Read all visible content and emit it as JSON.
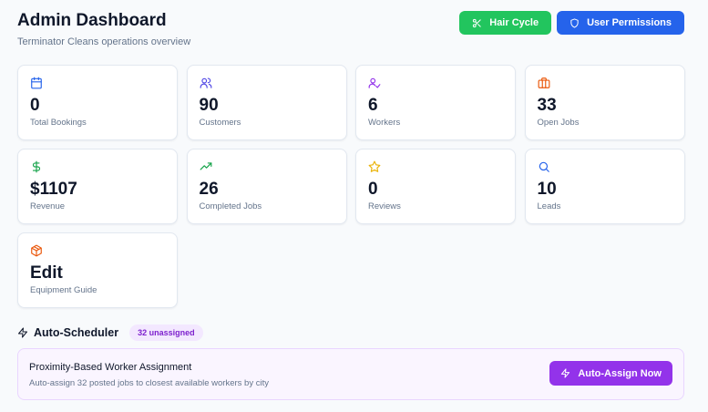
{
  "header": {
    "title": "Admin Dashboard",
    "subtitle": "Terminator Cleans operations overview",
    "actions": {
      "hair_cycle_label": "Hair Cycle",
      "user_permissions_label": "User Permissions"
    }
  },
  "stats": [
    {
      "icon": "calendar-icon",
      "value": "0",
      "label": "Total Bookings",
      "color": "#2563eb"
    },
    {
      "icon": "users-icon",
      "value": "90",
      "label": "Customers",
      "color": "#4f46e5"
    },
    {
      "icon": "user-check-icon",
      "value": "6",
      "label": "Workers",
      "color": "#9333ea"
    },
    {
      "icon": "briefcase-icon",
      "value": "33",
      "label": "Open Jobs",
      "color": "#ea580c"
    },
    {
      "icon": "dollar-icon",
      "value": "$1107",
      "label": "Revenue",
      "color": "#16a34a"
    },
    {
      "icon": "trending-up-icon",
      "value": "26",
      "label": "Completed Jobs",
      "color": "#16a34a"
    },
    {
      "icon": "star-icon",
      "value": "0",
      "label": "Reviews",
      "color": "#eab308"
    },
    {
      "icon": "search-icon",
      "value": "10",
      "label": "Leads",
      "color": "#2563eb"
    },
    {
      "icon": "package-icon",
      "value": "Edit",
      "label": "Equipment Guide",
      "color": "#ea580c"
    }
  ],
  "scheduler": {
    "title": "Auto-Scheduler",
    "badge": "32 unassigned",
    "panel_title": "Proximity-Based Worker Assignment",
    "panel_desc": "Auto-assign 32 posted jobs to closest available workers by city",
    "button_label": "Auto-Assign Now"
  },
  "colors": {
    "green": "#22c55e",
    "blue": "#2563eb",
    "purple": "#9333ea"
  }
}
